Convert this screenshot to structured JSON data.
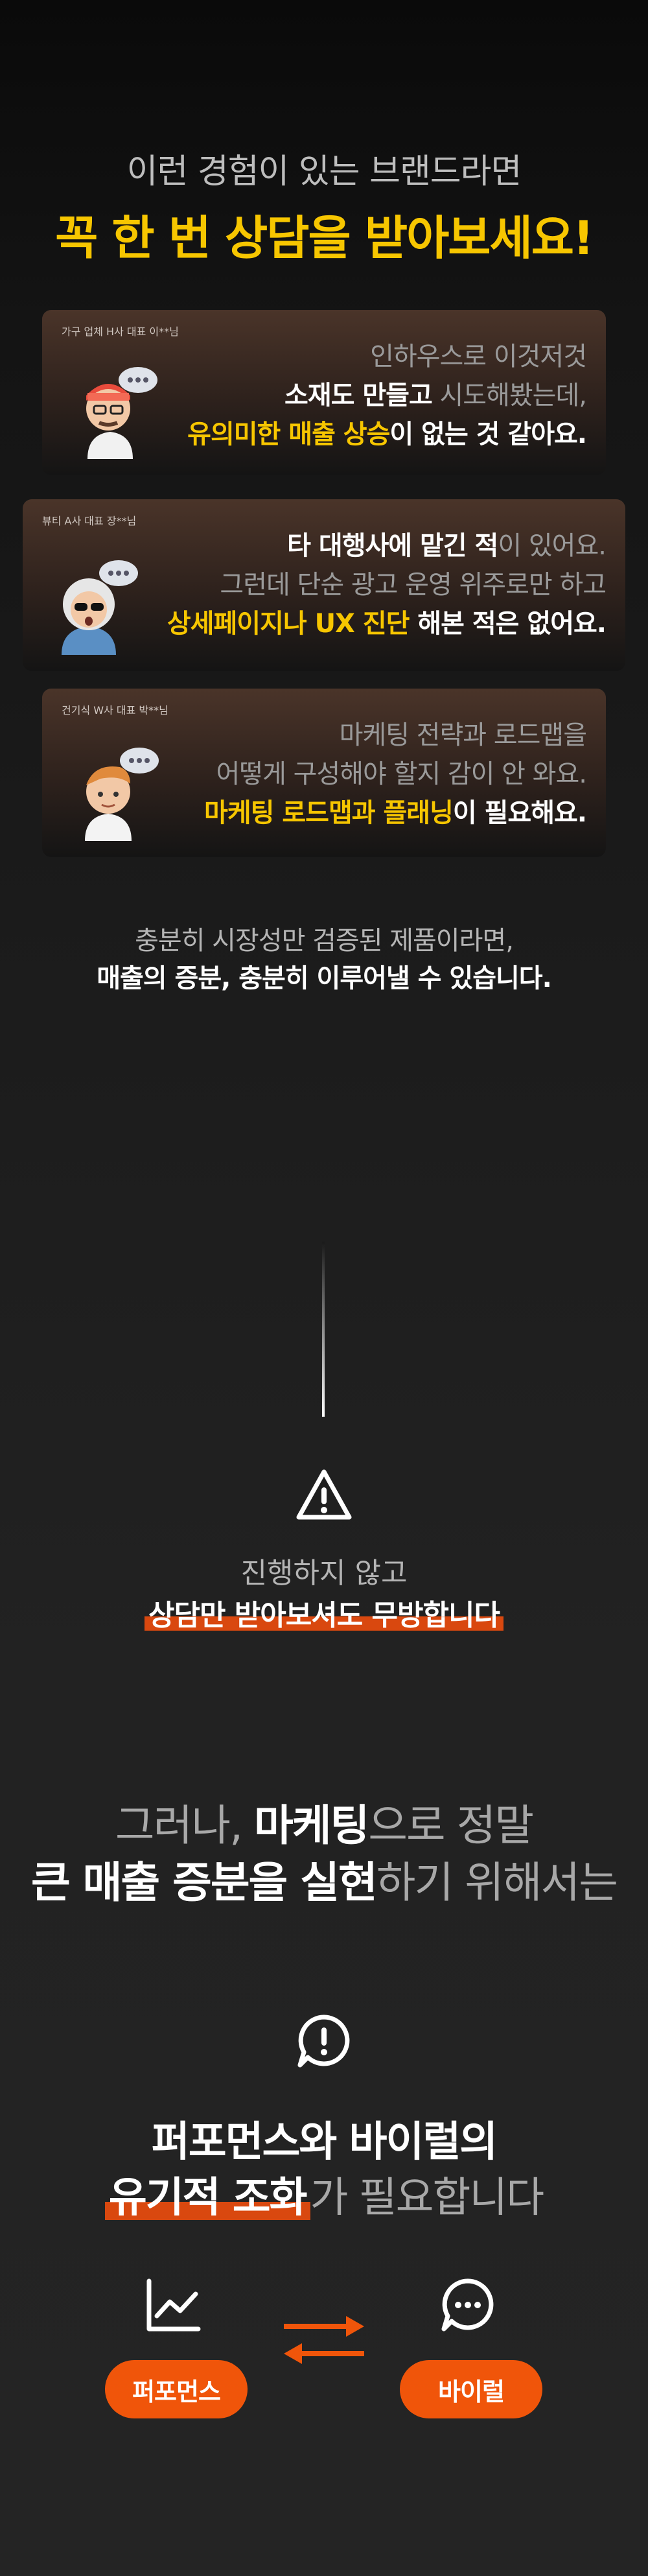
{
  "hero": {
    "subtitle": "이런 경험이 있는 브랜드라면",
    "title": "꼭 한 번 상담을 받아보세요!"
  },
  "cards": [
    {
      "label": "가구 업체 H사 대표 이**님",
      "line1": "인하우스로 이것저것",
      "line2_bold": "소재도 만들고",
      "line2_rest": " 시도해봤는데,",
      "line3_hl": "유의미한 매출 상승",
      "line3_rest": "이 없는 것 같아요."
    },
    {
      "label": "뷰티 A사 대표 장**님",
      "line1_bold": "타 대행사에 맡긴 적",
      "line1_rest": "이 있어요.",
      "line2": "그런데 단순 광고 운영 위주로만 하고",
      "line3_hl": "상세페이지나 UX 진단",
      "line3_rest": " 해본 적은 없어요."
    },
    {
      "label": "건기식 W사 대표 박**님",
      "line1": "마케팅 전략과 로드맵을",
      "line2": "어떻게 구성해야 할지 감이 안 와요.",
      "line3_hl": "마케팅 로드맵과 플래닝",
      "line3_rest": "이 필요해요."
    }
  ],
  "middle": {
    "line1": "충분히 시장성만 검증된 제품이라면,",
    "line2": "매출의 증분, 충분히 이루어낼 수 있습니다."
  },
  "warning": {
    "icon": "warning-triangle-icon",
    "line1": "진행하지 않고",
    "line2": "상담만 받아보셔도 무방합니다"
  },
  "however": {
    "line1_a": "그러나, ",
    "line1_b": "마케팅",
    "line1_c": "으로 정말",
    "line2_a": "큰 매출 증분을 실현",
    "line2_b": "하기 위해서는"
  },
  "organic": {
    "icon": "alert-chat-icon",
    "line1": "퍼포먼스와 바이럴의",
    "line2_hl": "유기적 조화",
    "line2_rest": "가 필요합니다"
  },
  "bottom": {
    "left_icon": "line-chart-icon",
    "right_icon": "chat-dots-icon",
    "exchange_icon": "exchange-arrows-icon",
    "left_label": "퍼포먼스",
    "right_label": "바이럴",
    "accent": "#f0550a"
  }
}
